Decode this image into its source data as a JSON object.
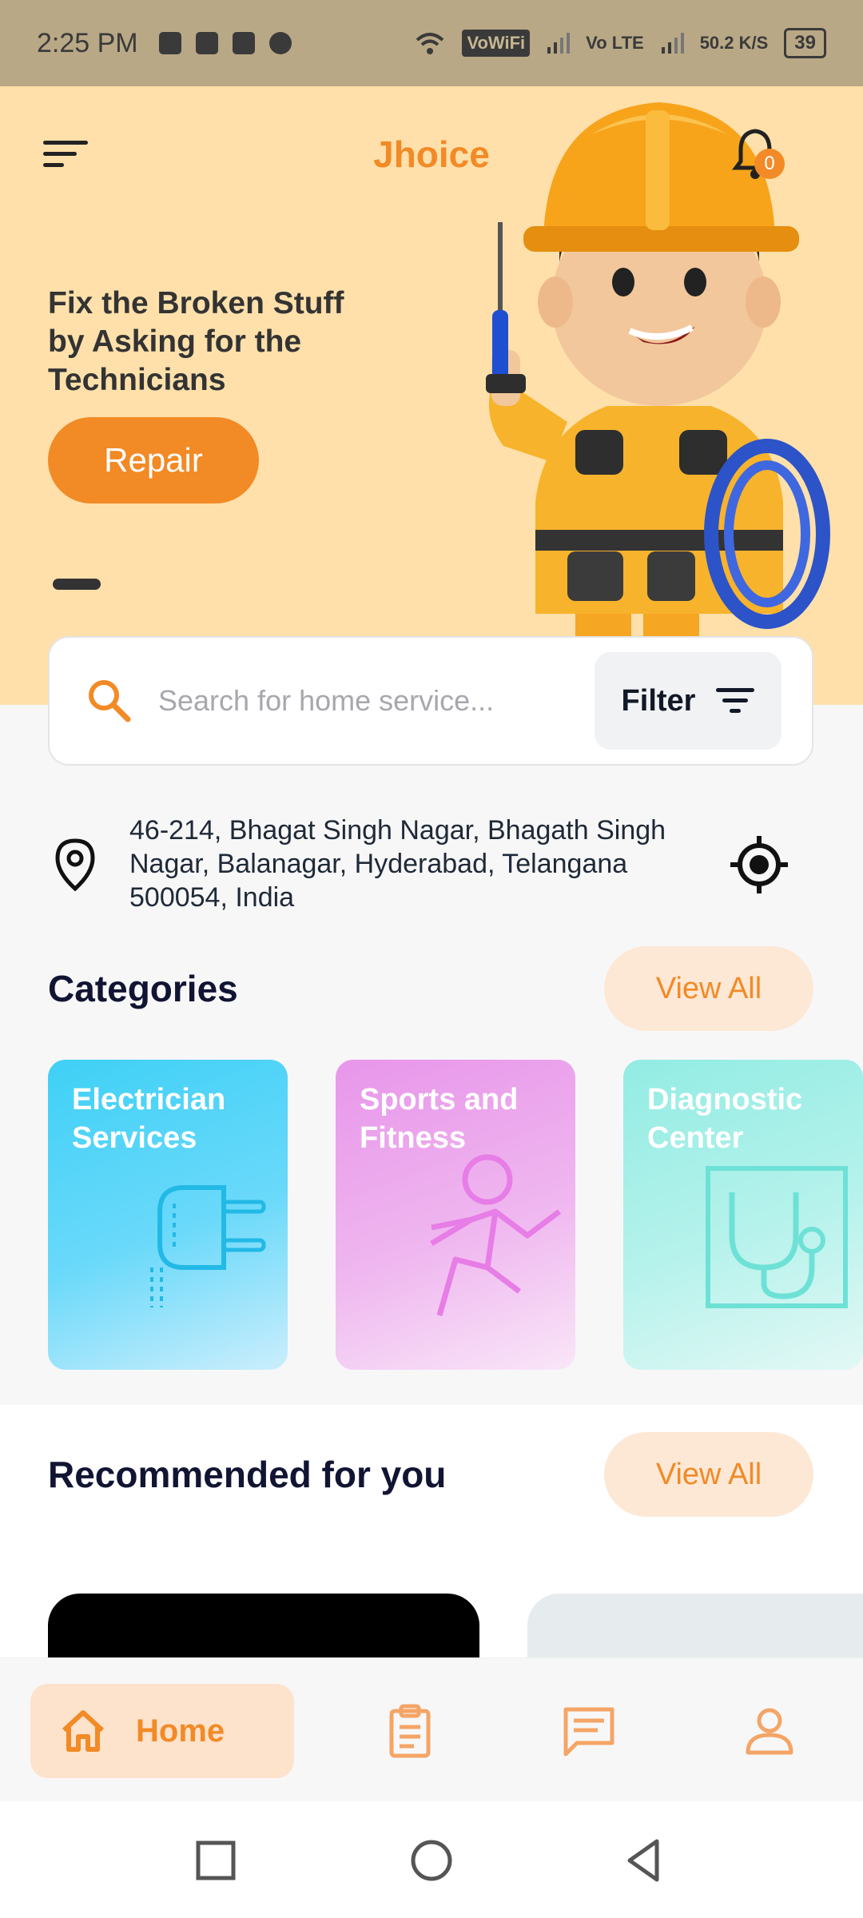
{
  "status_bar": {
    "time": "2:25 PM",
    "vowifi": "VoWiFi",
    "volte": "Vo LTE",
    "speed": "50.2 K/S",
    "battery": "39"
  },
  "header": {
    "brand": "Jhoice",
    "notification_count": "0"
  },
  "hero": {
    "title": "Fix the Broken Stuff by Asking for the Technicians",
    "button_label": "Repair"
  },
  "search": {
    "placeholder": "Search for home service...",
    "filter_label": "Filter"
  },
  "location": {
    "address": "46-214, Bhagat Singh Nagar, Bhagath Singh Nagar, Balanagar, Hyderabad, Telangana 500054, India"
  },
  "categories": {
    "title": "Categories",
    "view_all": "View All",
    "items": [
      {
        "label": "Electrician Services",
        "icon": "plug-icon"
      },
      {
        "label": "Sports and Fitness",
        "icon": "running-person-icon"
      },
      {
        "label": "Diagnostic Center",
        "icon": "stethoscope-icon"
      }
    ]
  },
  "recommended": {
    "title": "Recommended for you",
    "view_all": "View All"
  },
  "bottom_nav": {
    "home_label": "Home",
    "items": [
      "home-icon",
      "clipboard-icon",
      "chat-icon",
      "profile-icon"
    ]
  },
  "colors": {
    "accent": "#f28a26",
    "hero_bg": "#ffe0aa",
    "heading": "#111533"
  }
}
